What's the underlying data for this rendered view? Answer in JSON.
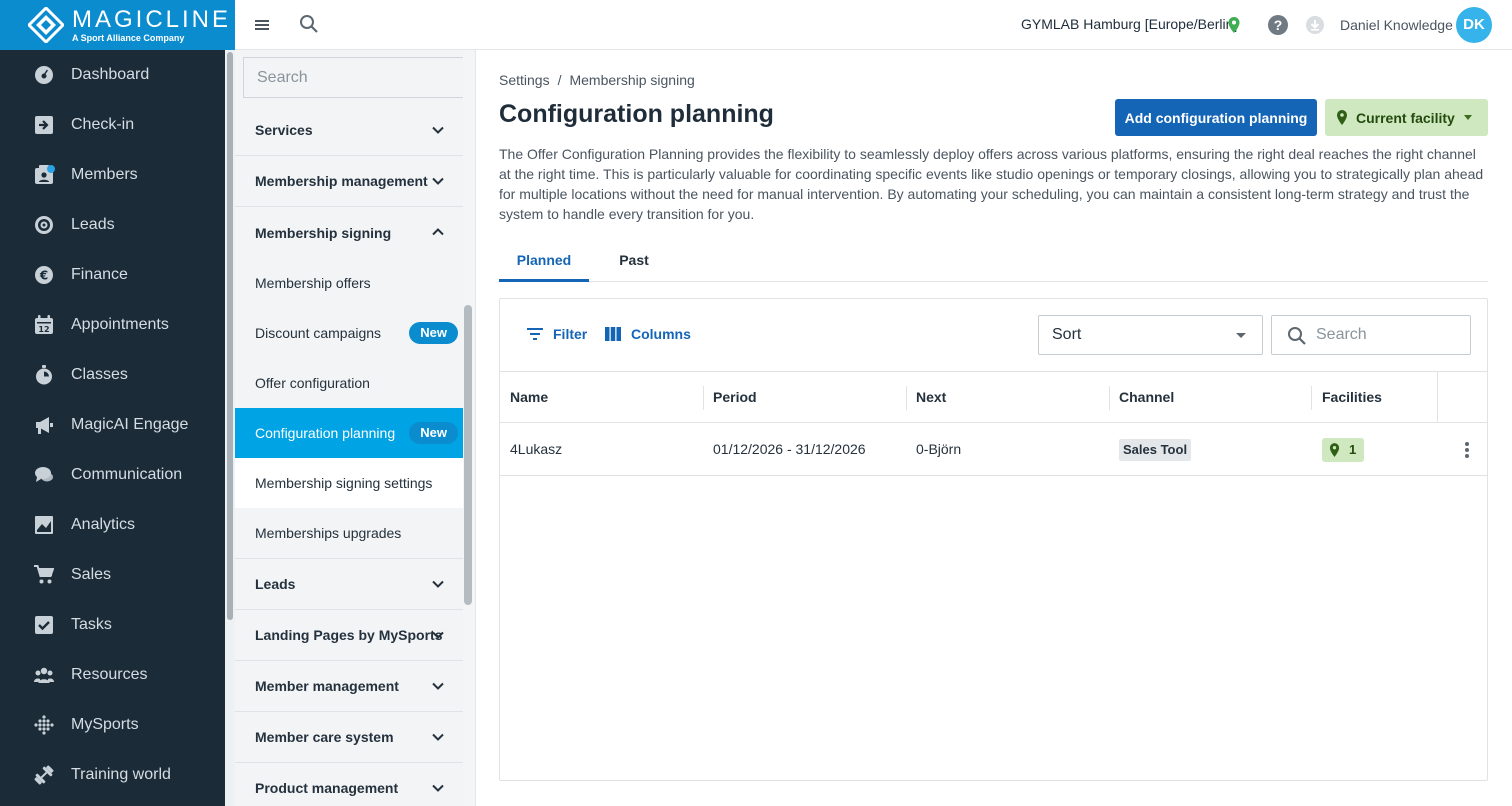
{
  "brand": {
    "name": "MAGICLINE",
    "tagline": "A Sport Alliance Company",
    "color": "#0b8ccf"
  },
  "nav": {
    "items": [
      {
        "label": "Dashboard",
        "icon": "dashboard-icon"
      },
      {
        "label": "Check-in",
        "icon": "check-in-icon"
      },
      {
        "label": "Members",
        "icon": "members-icon"
      },
      {
        "label": "Leads",
        "icon": "leads-icon"
      },
      {
        "label": "Finance",
        "icon": "finance-icon"
      },
      {
        "label": "Appointments",
        "icon": "calendar-icon"
      },
      {
        "label": "Classes",
        "icon": "stopwatch-icon"
      },
      {
        "label": "MagicAI Engage",
        "icon": "megaphone-icon"
      },
      {
        "label": "Communication",
        "icon": "chat-icon"
      },
      {
        "label": "Analytics",
        "icon": "chart-icon"
      },
      {
        "label": "Sales",
        "icon": "cart-icon"
      },
      {
        "label": "Tasks",
        "icon": "checkbox-icon"
      },
      {
        "label": "Resources",
        "icon": "people-icon"
      },
      {
        "label": "MySports",
        "icon": "grid-dots-icon"
      },
      {
        "label": "Training world",
        "icon": "dumbbell-icon"
      }
    ]
  },
  "topbar": {
    "facility": "GYMLAB Hamburg [Europe/Berlin]",
    "help": "?",
    "user": "Daniel Knowledge",
    "avatar_initials": "DK"
  },
  "subnav": {
    "search_placeholder": "Search",
    "sections": {
      "services": "Services",
      "membership_management": "Membership management",
      "membership_signing": "Membership signing",
      "leads": "Leads",
      "landing_pages": "Landing Pages by MySports",
      "member_management": "Member management",
      "member_care": "Member care system",
      "product_management": "Product management"
    },
    "signing_items": {
      "offers": "Membership offers",
      "discounts": "Discount campaigns",
      "offer_config": "Offer configuration",
      "config_planning": "Configuration planning",
      "signing_settings": "Membership signing settings",
      "upgrades": "Memberships upgrades"
    },
    "badge_new": "New"
  },
  "main": {
    "breadcrumb": {
      "root": "Settings",
      "sep": "/",
      "current": "Membership signing"
    },
    "title": "Configuration planning",
    "add_button": "Add configuration planning",
    "facility_button": "Current facility",
    "description": "The Offer Configuration Planning provides the flexibility to seamlessly deploy offers across various platforms, ensuring the right deal reaches the right channel at the right time. This is particularly valuable for coordinating specific events like studio openings or temporary closings, allowing you to strategically plan ahead for multiple locations without the need for manual intervention. By automating your scheduling, you can maintain a consistent long-term strategy and trust the system to handle every transition for you.",
    "tabs": {
      "planned": "Planned",
      "past": "Past"
    },
    "toolbar": {
      "filter": "Filter",
      "columns": "Columns",
      "sort": "Sort",
      "search_placeholder": "Search"
    },
    "table": {
      "headers": {
        "name": "Name",
        "period": "Period",
        "next": "Next",
        "channel": "Channel",
        "facilities": "Facilities"
      },
      "rows": [
        {
          "name": "4Lukasz",
          "period": "01/12/2026 - 31/12/2026",
          "next": "0-Björn",
          "channel": "Sales Tool",
          "facilities": "1"
        }
      ]
    }
  },
  "colors": {
    "nav_bg": "#1b2b37",
    "primary": "#1565b7",
    "active_item": "#00a3e3",
    "facility_green": "#cfe8c0",
    "pin_green": "#3fae52"
  }
}
